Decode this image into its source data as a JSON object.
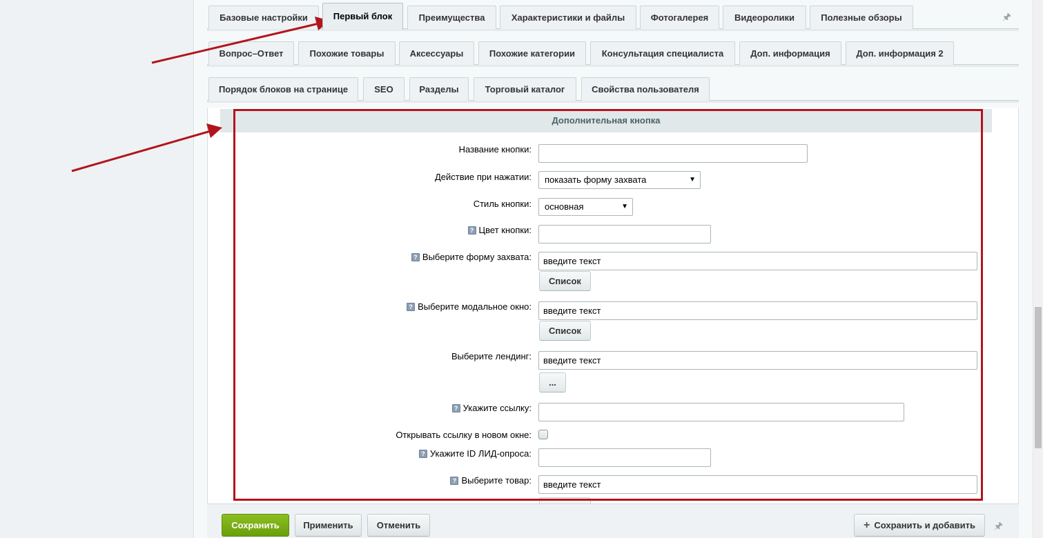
{
  "tabs_row1": [
    "Базовые настройки",
    "Первый блок",
    "Преимущества",
    "Характеристики и файлы",
    "Фотогалерея",
    "Видеоролики",
    "Полезные обзоры"
  ],
  "tabs_row2": [
    "Вопрос–Ответ",
    "Похожие товары",
    "Аксессуары",
    "Похожие категории",
    "Консультация специалиста",
    "Доп. информация",
    "Доп. информация 2"
  ],
  "tabs_row3": [
    "Порядок блоков на странице",
    "SEO",
    "Разделы",
    "Торговый каталог",
    "Свойства пользователя"
  ],
  "active_tab": "Первый блок",
  "section_title": "Дополнительная кнопка",
  "form": {
    "button_name_label": "Название кнопки:",
    "button_name_value": "",
    "action_label": "Действие при нажатии:",
    "action_value": "показать форму захвата",
    "style_label": "Стиль кнопки:",
    "style_value": "основная",
    "color_label": "Цвет кнопки:",
    "color_value": "",
    "capture_form_label": "Выберите форму захвата:",
    "capture_form_value": "введите текст",
    "list_button": "Список",
    "modal_label": "Выберите модальное окно:",
    "modal_value": "введите текст",
    "landing_label": "Выберите лендинг:",
    "landing_value": "введите текст",
    "browse_button": "...",
    "link_label": "Укажите ссылку:",
    "link_value": "",
    "new_window_label": "Открывать ссылку в новом окне:",
    "new_window_checked": false,
    "lead_id_label": "Укажите ID ЛИД-опроса:",
    "lead_id_value": "",
    "product_label": "Выберите товар:",
    "product_value": "введите текст",
    "hint_glyph": "?"
  },
  "footer": {
    "save": "Сохранить",
    "apply": "Применить",
    "cancel": "Отменить",
    "save_add": "Сохранить и добавить",
    "plus_glyph": "+"
  },
  "colors": {
    "annotation_red": "#b3141b",
    "save_green": "#7aae14"
  }
}
